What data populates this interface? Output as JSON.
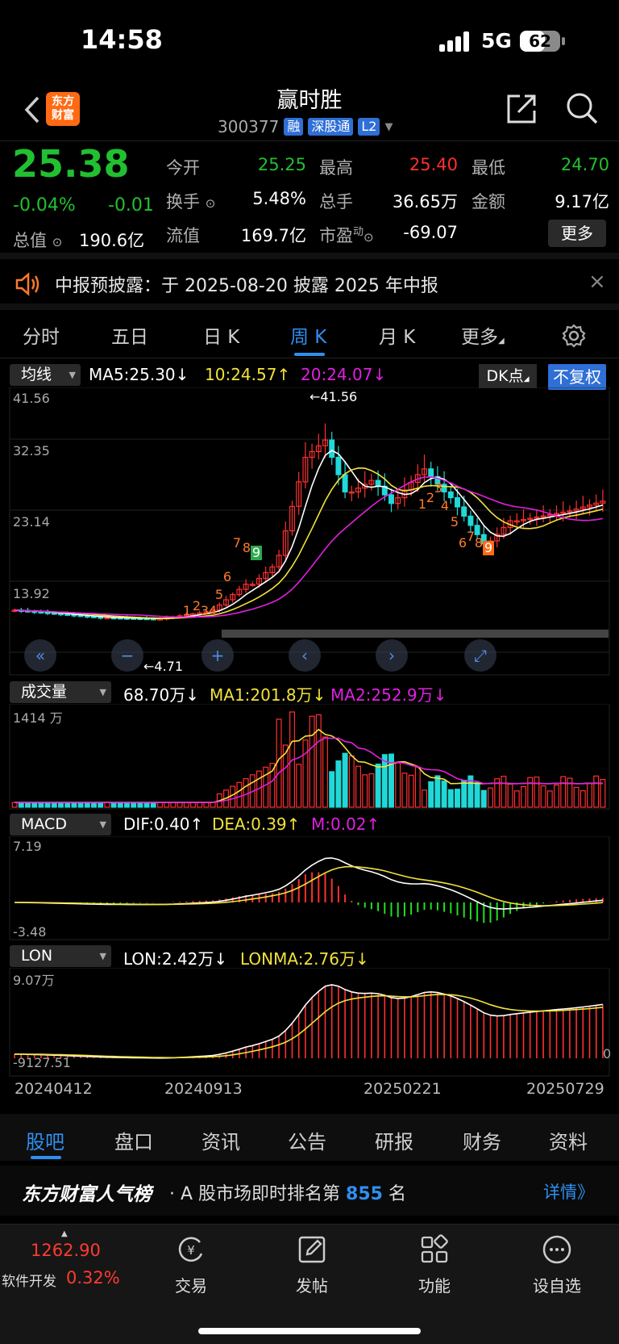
{
  "status": {
    "time": "14:58",
    "network": "5G",
    "battery": "62",
    "battery_level": 0.62
  },
  "header": {
    "logo_line1": "东方",
    "logo_line2": "财富",
    "title": "赢时胜",
    "code": "300377",
    "tags": [
      "融",
      "深股通",
      "L2"
    ]
  },
  "quote": {
    "price": "25.38",
    "change_pct": "-0.04%",
    "change": "-0.01",
    "open_label": "今开",
    "open": "25.25",
    "high_label": "最高",
    "high": "25.40",
    "low_label": "最低",
    "low": "24.70",
    "turnover_label": "换手",
    "turnover": "5.48%",
    "volume_label": "总手",
    "volume": "36.65万",
    "amount_label": "金额",
    "amount": "9.17亿",
    "mktcap_label": "总值",
    "mktcap": "190.6亿",
    "float_label": "流值",
    "float": "169.7亿",
    "pe_label": "市盈",
    "pe_sup": "动",
    "pe": "-69.07",
    "more": "更多"
  },
  "notice": {
    "text": "中报预披露：于 2025-08-20 披露 2025 年中报"
  },
  "tabs": [
    "分时",
    "五日",
    "日 K",
    "周 K",
    "月 K",
    "更多"
  ],
  "main_indicator": {
    "selector": "均线",
    "ma5": "MA5:25.30↓",
    "ma10": "10:24.57↑",
    "ma20": "20:24.07↓",
    "dk": "DK点",
    "fuquan": "不复权",
    "y_labels": [
      "41.56",
      "32.35",
      "23.14",
      "13.92"
    ],
    "high_mark": "←41.56",
    "low_mark": "←4.71"
  },
  "volume_indicator": {
    "selector": "成交量",
    "vol": "68.70万↓",
    "ma1": "MA1:201.8万↓",
    "ma2": "MA2:252.9万↓",
    "y_top": "1414 万"
  },
  "macd_indicator": {
    "selector": "MACD",
    "dif": "DIF:0.40↑",
    "dea": "DEA:0.39↑",
    "m": "M:0.02↑",
    "y_top": "7.19",
    "y_bottom": "-3.48"
  },
  "lon_indicator": {
    "selector": "LON",
    "lon": "LON:2.42万↓",
    "lonma": "LONMA:2.76万↓",
    "y_top": "9.07万",
    "y_bottom": "-9127.51",
    "y_right": "0"
  },
  "dates": [
    "20240412",
    "20240913",
    "20250221",
    "20250729"
  ],
  "bottom_tabs": [
    "股吧",
    "盘口",
    "资讯",
    "公告",
    "研报",
    "财务",
    "资料"
  ],
  "rank": {
    "brand": "东方财富人气榜",
    "text_pre": "· A 股市场即时排名第",
    "num": "855",
    "text_post": "名",
    "detail": "详情》"
  },
  "bottom_bar": {
    "index_value": "1262.90",
    "index_name": "软件开发",
    "index_pct": "0.32%",
    "items": [
      {
        "label": "交易",
        "icon": "trade-icon"
      },
      {
        "label": "发帖",
        "icon": "post-icon"
      },
      {
        "label": "功能",
        "icon": "function-icon"
      },
      {
        "label": "设自选",
        "icon": "add-watchlist-icon"
      }
    ]
  },
  "chart_data": {
    "type": "candlestick",
    "title": "",
    "y_range": [
      4.71,
      41.56
    ],
    "highest": 41.56,
    "lowest": 4.71,
    "ma_values": {
      "MA5": 25.3,
      "MA10": 24.57,
      "MA20": 24.07
    },
    "sequence_labels_up": [
      "1",
      "2",
      "3",
      "4",
      "5",
      "6",
      "7",
      "8",
      "9"
    ],
    "sequence_labels_down": [
      "1",
      "2",
      "3",
      "4",
      "5",
      "6",
      "7",
      "8",
      "9"
    ],
    "colors": {
      "up": "#ff3030",
      "down": "#20d8d8",
      "ma5": "#ffffff",
      "ma10": "#f2e23a",
      "ma20": "#e020e0"
    }
  }
}
